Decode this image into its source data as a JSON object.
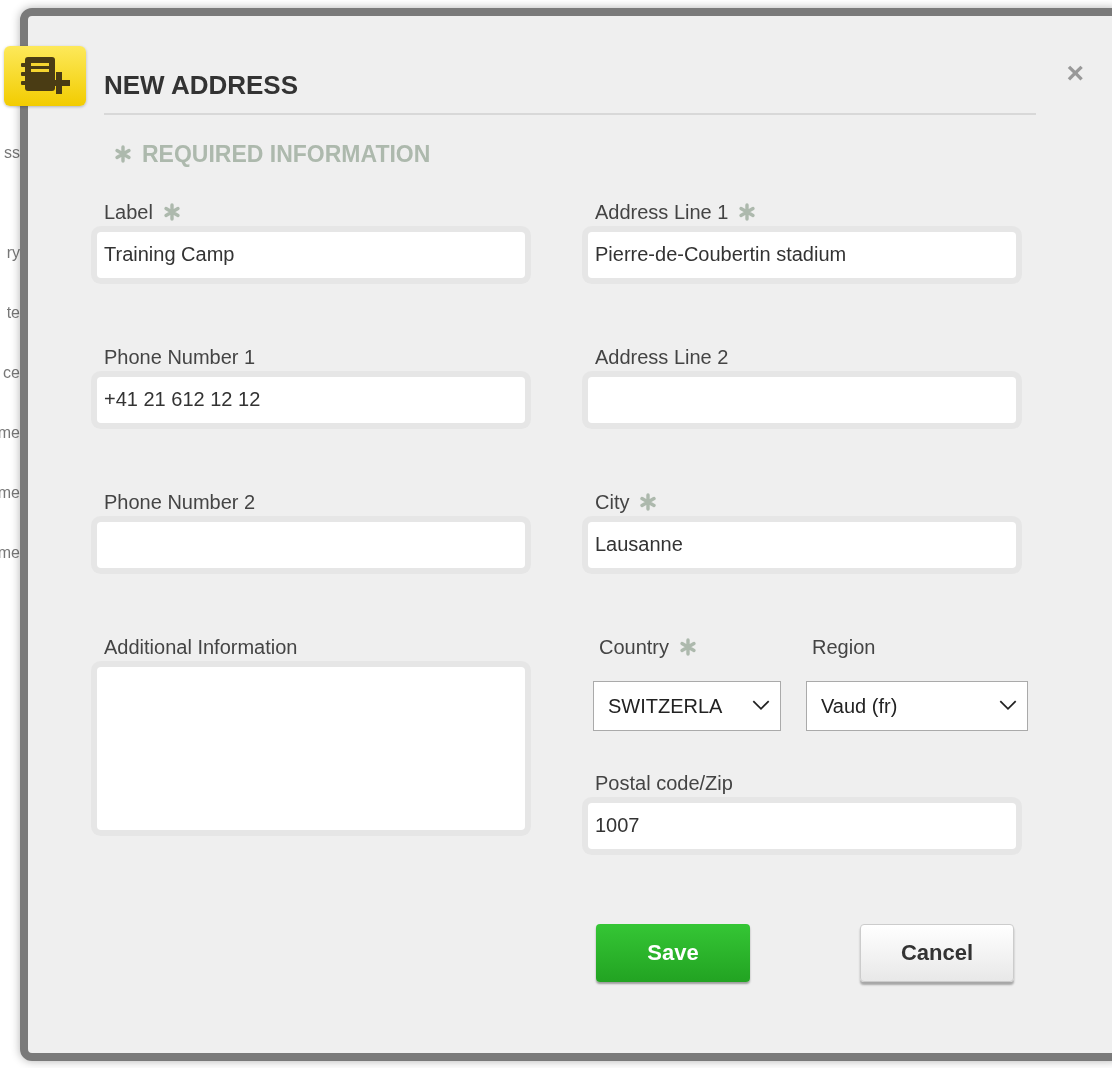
{
  "background": {
    "fragments": [
      "ss",
      "ry",
      "te",
      "ce",
      "me",
      "me",
      "me"
    ]
  },
  "dialog": {
    "title": "NEW ADDRESS",
    "close": "×",
    "required_note": "REQUIRED INFORMATION",
    "left": [
      {
        "kind": "input",
        "label": "Label",
        "required": true,
        "value": "Training Camp"
      },
      {
        "kind": "input",
        "label": "Phone Number 1",
        "required": false,
        "value": "+41 21 612 12 12"
      },
      {
        "kind": "input",
        "label": "Phone Number 2",
        "required": false
      },
      {
        "kind": "textarea",
        "label": "Additional Information",
        "required": false
      }
    ],
    "right": [
      {
        "kind": "input",
        "label": "Address Line 1",
        "required": true,
        "value": "Pierre-de-Coubertin stadium"
      },
      {
        "kind": "input",
        "label": "Address Line 2",
        "required": false
      },
      {
        "kind": "input",
        "label": "City",
        "required": true,
        "value": "Lausanne"
      },
      {
        "kind": "select_pair",
        "fields": [
          {
            "label": "Country",
            "required": true,
            "value": "SWITZERLA"
          },
          {
            "label": "Region",
            "required": false,
            "value": "Vaud (fr)"
          }
        ]
      },
      {
        "kind": "input",
        "label": "Postal code/Zip",
        "required": false,
        "value": "1007"
      }
    ],
    "buttons": [
      {
        "label": "Save",
        "kind": "primary"
      },
      {
        "label": "Cancel",
        "kind": "secondary"
      }
    ]
  }
}
